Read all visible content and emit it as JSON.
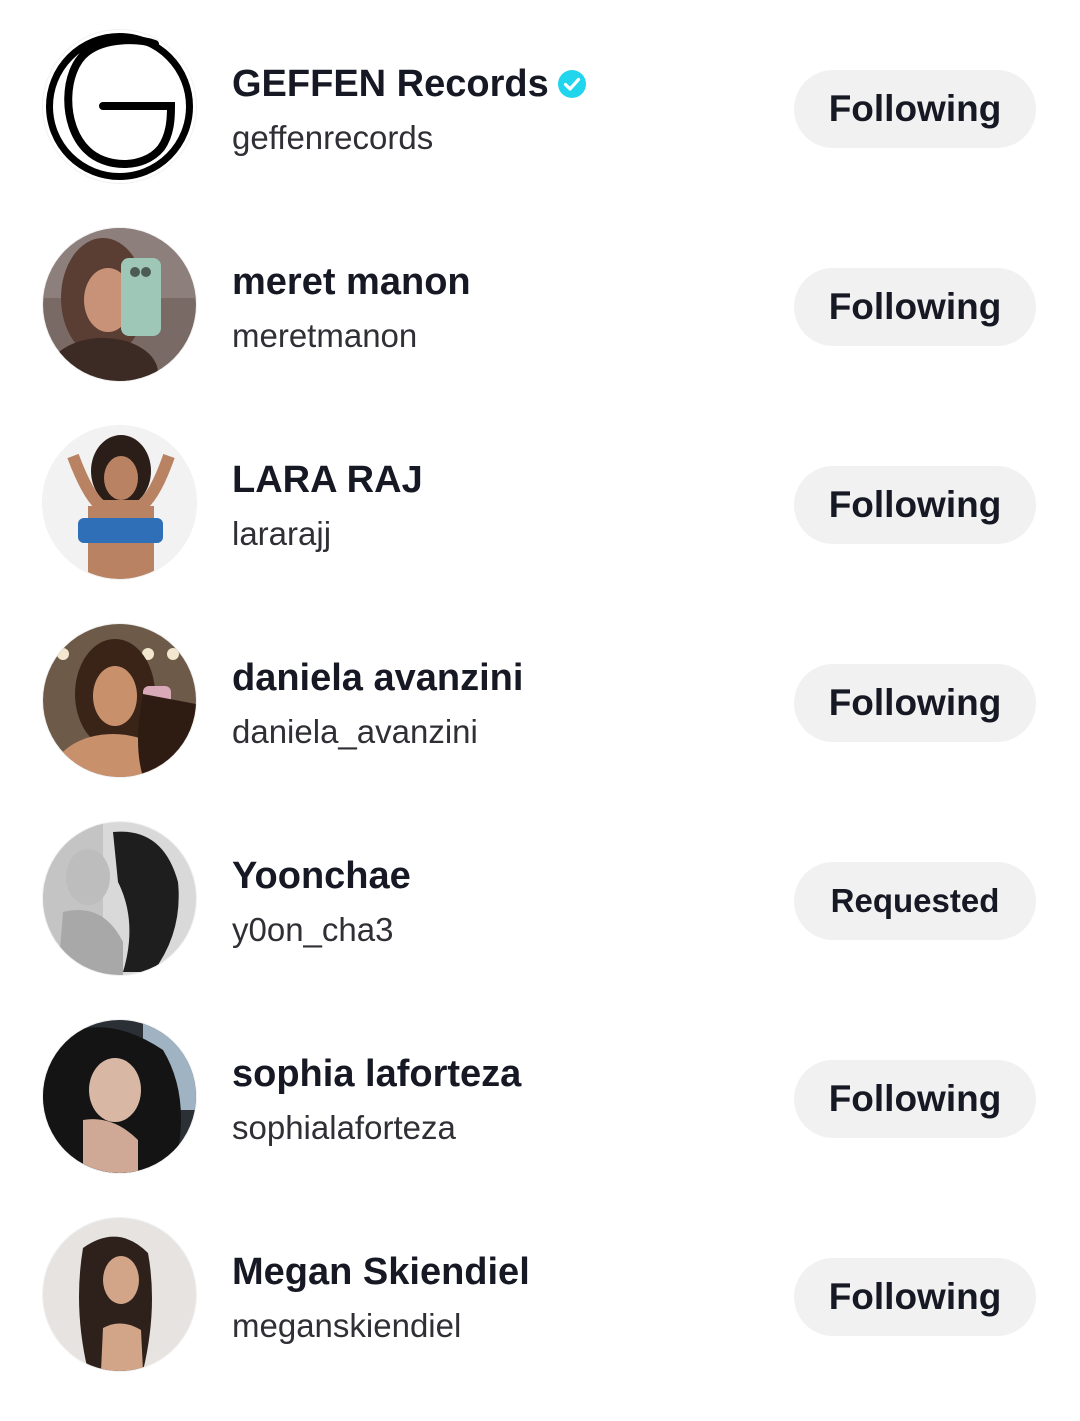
{
  "accounts": [
    {
      "display_name": "GEFFEN Records",
      "username": "geffenrecords",
      "verified": true,
      "button_label": "Following",
      "avatar_icon": "geffen-logo-icon"
    },
    {
      "display_name": "meret manon",
      "username": "meretmanon",
      "verified": false,
      "button_label": "Following",
      "avatar_icon": "profile-photo"
    },
    {
      "display_name": "LARA RAJ",
      "username": "lararajj",
      "verified": false,
      "button_label": "Following",
      "avatar_icon": "profile-photo"
    },
    {
      "display_name": "daniela avanzini",
      "username": "daniela_avanzini",
      "verified": false,
      "button_label": "Following",
      "avatar_icon": "profile-photo"
    },
    {
      "display_name": "Yoonchae",
      "username": "y0on_cha3",
      "verified": false,
      "button_label": "Requested",
      "avatar_icon": "profile-photo"
    },
    {
      "display_name": "sophia laforteza",
      "username": "sophialaforteza",
      "verified": false,
      "button_label": "Following",
      "avatar_icon": "profile-photo"
    },
    {
      "display_name": "Megan Skiendiel",
      "username": "meganskiendiel",
      "verified": false,
      "button_label": "Following",
      "avatar_icon": "profile-photo"
    }
  ],
  "colors": {
    "verified_badge": "#20d5ec",
    "button_bg": "#f1f1f2",
    "text": "#161823"
  }
}
